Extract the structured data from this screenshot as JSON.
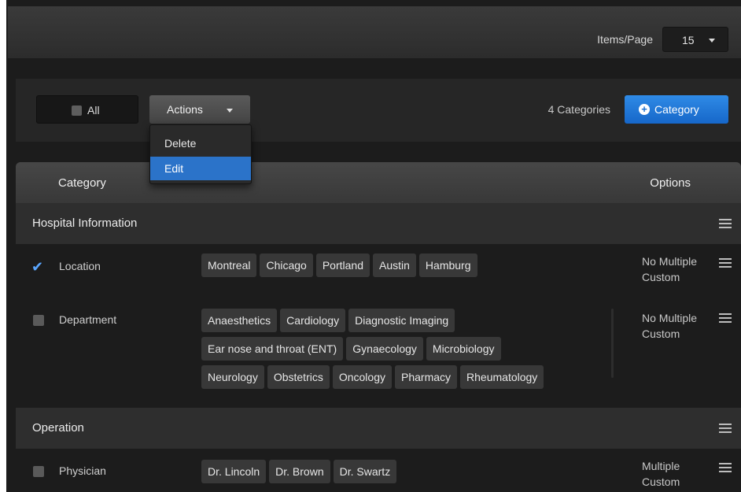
{
  "header": {
    "items_per_page_label": "Items/Page",
    "items_per_page_value": "15"
  },
  "toolbar": {
    "all_label": "All",
    "actions_label": "Actions",
    "category_count": "4 Categories",
    "add_category_label": "Category"
  },
  "actions_menu": {
    "items": [
      "Delete",
      "Edit"
    ],
    "highlighted": "Edit"
  },
  "table": {
    "columns": {
      "category": "Category",
      "options": "Options"
    },
    "groups": [
      {
        "title": "Hospital Information",
        "rows": [
          {
            "name": "Location",
            "checked": true,
            "tags": [
              "Montreal",
              "Chicago",
              "Portland",
              "Austin",
              "Hamburg"
            ],
            "options": [
              "No Multiple",
              "Custom"
            ]
          },
          {
            "name": "Department",
            "checked": false,
            "tags": [
              "Anaesthetics",
              "Cardiology",
              "Diagnostic Imaging",
              "Ear nose and throat (ENT)",
              "Gynaecology",
              "Microbiology",
              "Neurology",
              "Obstetrics",
              "Oncology",
              "Pharmacy",
              "Rheumatology"
            ],
            "options": [
              "No Multiple",
              "Custom"
            ]
          }
        ]
      },
      {
        "title": "Operation",
        "rows": [
          {
            "name": "Physician",
            "checked": false,
            "tags": [
              "Dr. Lincoln",
              "Dr. Brown",
              "Dr. Swartz"
            ],
            "options": [
              "Multiple",
              "Custom"
            ]
          }
        ]
      }
    ]
  },
  "colors": {
    "accent": "#2b73c9",
    "background": "#1c1c1c",
    "tag": "#383838"
  }
}
